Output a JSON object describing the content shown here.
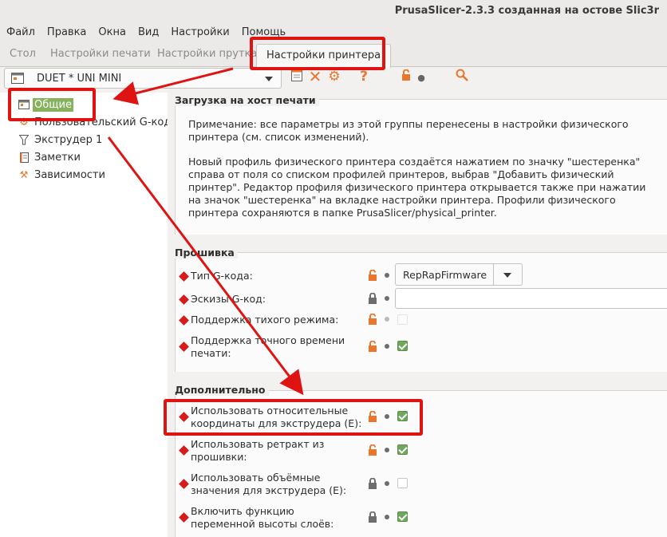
{
  "window": {
    "title": "PrusaSlicer-2.3.3 созданная на остове Slic3r"
  },
  "menu": [
    "Файл",
    "Правка",
    "Окна",
    "Вид",
    "Настройки",
    "Помощь"
  ],
  "tabs": [
    {
      "label": "Стол"
    },
    {
      "label": "Настройки печати"
    },
    {
      "label": "Настройки прутка"
    },
    {
      "label": "Настройки принтера"
    }
  ],
  "profile": {
    "selected": "DUET * UNI MINI"
  },
  "tree": [
    {
      "label": "Общие",
      "icon": "printer-settings-icon"
    },
    {
      "label": "Пользовательский G-код",
      "icon": "gear-icon"
    },
    {
      "label": "Экструдер 1",
      "icon": "funnel-icon"
    },
    {
      "label": "Заметки",
      "icon": "notes-icon"
    },
    {
      "label": "Зависимости",
      "icon": "wrench-icon"
    }
  ],
  "host_group": {
    "title": "Загрузка на хост печати",
    "note1": "Примечание: все параметры из этой группы перенесены в настройки физического принтера (см. список изменений).",
    "note2": "Новый профиль физического принтера создаётся нажатием по значку \"шестеренка\" справа от поля со списком профилей принтеров, выбрав \"Добавить физический принтер\". Редактор профиля физического принтера открывается также при нажатии на значок \"шестеренка\" на вкладке настройки принтера. Профили физического принтера сохраняются в папке PrusaSlicer/physical_printer."
  },
  "firmware_group": {
    "title": "Прошивка",
    "options": [
      {
        "label": "Тип G-кода:",
        "value": "RepRapFirmware"
      },
      {
        "label": "Эскизы G-код:",
        "value": ""
      },
      {
        "label": "Поддержка тихого режима:",
        "checked": false
      },
      {
        "label_line1": "Поддержка точного времени",
        "label_line2": "печати:",
        "checked": true
      }
    ]
  },
  "advanced_group": {
    "title": "Дополнительно",
    "options": [
      {
        "label_line1": "Использовать относительные",
        "label_line2": "координаты для экструдера (E):",
        "checked": true
      },
      {
        "label_line1": "Использовать ретракт из",
        "label_line2": "прошивки:",
        "checked": true
      },
      {
        "label_line1": "Использовать объёмные",
        "label_line2": "значения для экструдера (E):",
        "checked": false
      },
      {
        "label_line1": "Включить функцию",
        "label_line2": "переменной высоты слоёв:",
        "checked": true
      }
    ]
  },
  "colors": {
    "selected_bg": "#87b25d",
    "checkbox_on": "#6fa75b",
    "unlock_orange": "#e8762c",
    "required_dot": "#d81a1a",
    "annotation_red": "#e01313"
  }
}
